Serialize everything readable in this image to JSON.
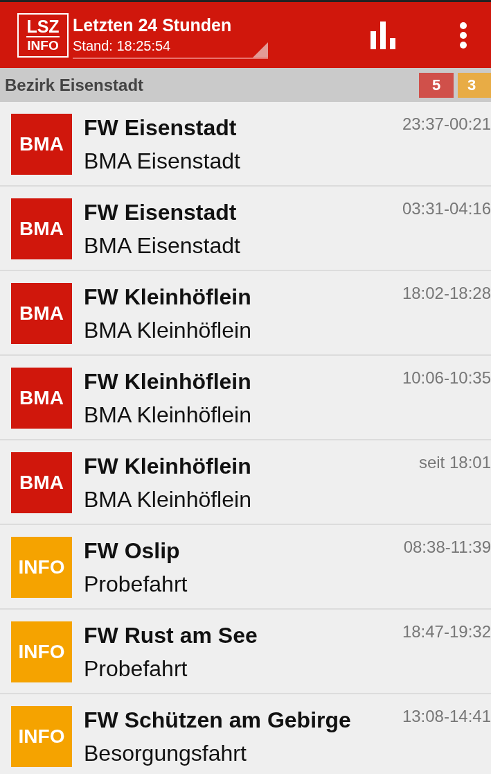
{
  "app_bar": {
    "logo_top": "LSZ",
    "logo_bottom": "INFO",
    "title": "Letzten 24 Stunden",
    "subtitle": "Stand: 18:25:54"
  },
  "section": {
    "title": "Bezirk Eisenstadt",
    "counters": [
      {
        "count": "5",
        "color": "#d0504a"
      },
      {
        "count": "3",
        "color": "#e8ac45"
      }
    ]
  },
  "incidents": [
    {
      "badge": "BMA",
      "color": "#d0170c",
      "station": "FW Eisenstadt",
      "description": "BMA Eisenstadt",
      "time": "23:37-00:21"
    },
    {
      "badge": "BMA",
      "color": "#d0170c",
      "station": "FW Eisenstadt",
      "description": "BMA Eisenstadt",
      "time": "03:31-04:16"
    },
    {
      "badge": "BMA",
      "color": "#d0170c",
      "station": "FW Kleinhöflein",
      "description": "BMA Kleinhöflein",
      "time": "18:02-18:28"
    },
    {
      "badge": "BMA",
      "color": "#d0170c",
      "station": "FW Kleinhöflein",
      "description": "BMA Kleinhöflein",
      "time": "10:06-10:35"
    },
    {
      "badge": "BMA",
      "color": "#d0170c",
      "station": "FW Kleinhöflein",
      "description": "BMA Kleinhöflein",
      "time": "seit 18:01"
    },
    {
      "badge": "INFO",
      "color": "#f5a300",
      "station": "FW Oslip",
      "description": "Probefahrt",
      "time": "08:38-11:39"
    },
    {
      "badge": "INFO",
      "color": "#f5a300",
      "station": "FW Rust am See",
      "description": "Probefahrt",
      "time": "18:47-19:32"
    },
    {
      "badge": "INFO",
      "color": "#f5a300",
      "station": "FW Schützen am Gebirge",
      "description": "Besorgungsfahrt",
      "time": "13:08-14:41"
    }
  ]
}
